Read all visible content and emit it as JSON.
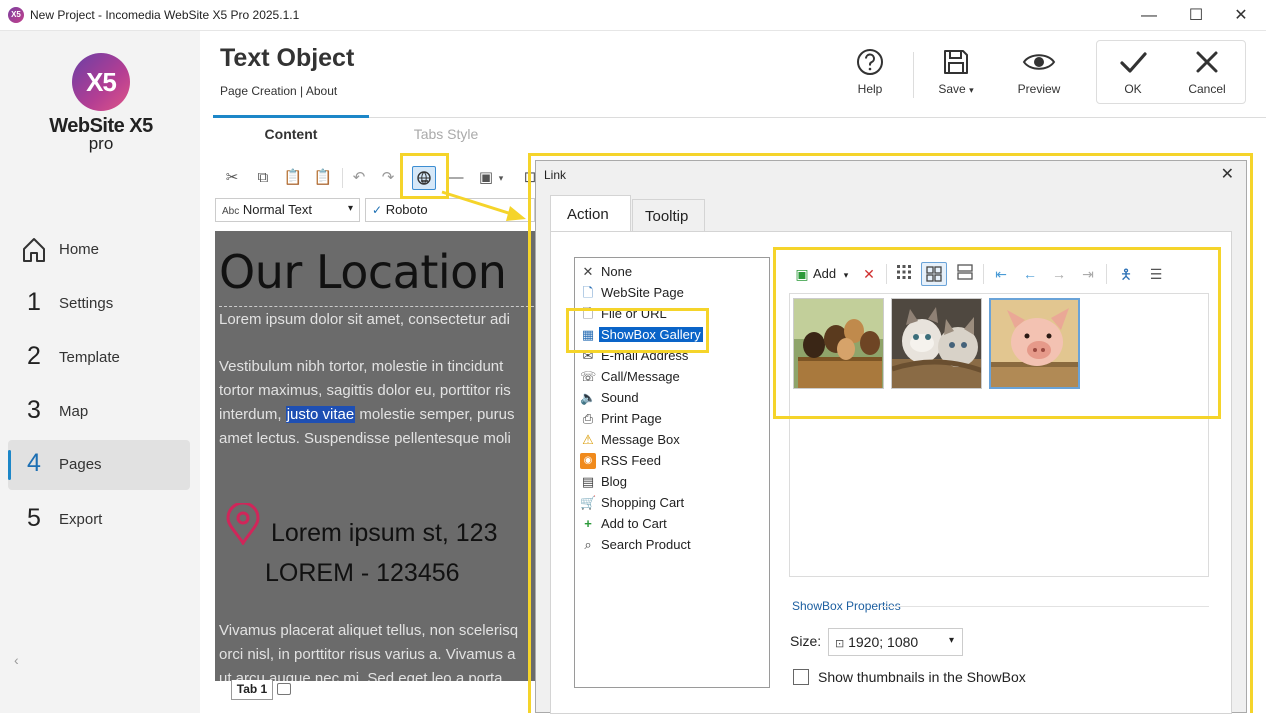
{
  "window": {
    "title": "New Project - Incomedia WebSite X5 Pro 2025.1.1",
    "app_icon": "X5",
    "minimize_icon": "—",
    "maximize_icon": "☐",
    "close_icon": "✕"
  },
  "logo": {
    "mark": "X5",
    "name": "WebSite X5",
    "edition": "pro"
  },
  "sidebar": {
    "items": [
      {
        "num": "",
        "label": "Home",
        "icon": "home-icon"
      },
      {
        "num": "1",
        "label": "Settings"
      },
      {
        "num": "2",
        "label": "Template"
      },
      {
        "num": "3",
        "label": "Map"
      },
      {
        "num": "4",
        "label": "Pages",
        "active": true
      },
      {
        "num": "5",
        "label": "Export"
      }
    ],
    "collapse_glyph": "‹"
  },
  "header": {
    "title": "Text Object",
    "breadcrumb": "Page Creation | About",
    "buttons": {
      "help": "Help",
      "save": "Save",
      "save_arrow": "▾",
      "preview": "Preview",
      "ok": "OK",
      "cancel": "Cancel"
    }
  },
  "tabs": {
    "content": "Content",
    "tabs_style": "Tabs Style"
  },
  "editor_toolbar": {
    "style_prefix": "Abc",
    "style_value": "Normal Text",
    "font_check": "✓",
    "font_value": "Roboto",
    "combo_arrow": "▾"
  },
  "editor": {
    "heading": "Our Location",
    "para1": "Lorem ipsum dolor sit amet, consectetur adi",
    "para2_line1": "Vestibulum nibh tortor, molestie in tincidunt",
    "para2_line2": "tortor maximus, sagittis dolor eu, porttitor ris",
    "para2_line3_a": "interdum, ",
    "para2_line3_sel": "justo vitae",
    "para2_line3_b": " molestie semper, purus",
    "para2_line4": "amet lectus. Suspendisse pellentesque moli",
    "address1": "Lorem ipsum st, 123",
    "address2": "LOREM - 123456",
    "para3_line1": "Vivamus placerat aliquet tellus, non scelerisq",
    "para3_line2": "orci nisl, in porttitor risus varius a. Vivamus a",
    "para3_line3": "ut arcu augue nec mi. Sed eget leo a porta"
  },
  "editor_tabs": {
    "tab1": "Tab 1"
  },
  "link_dialog": {
    "title": "Link",
    "close": "✕",
    "tabs": {
      "action": "Action",
      "tooltip": "Tooltip"
    },
    "actions": [
      {
        "label": "None",
        "icon": "none-x-icon",
        "glyph": "✕"
      },
      {
        "label": "WebSite Page",
        "icon": "page-icon",
        "glyph": "🗋"
      },
      {
        "label": "File or URL",
        "icon": "file-icon",
        "glyph": "🗋"
      },
      {
        "label": "ShowBox Gallery",
        "icon": "gallery-icon",
        "glyph": "▦",
        "selected": true
      },
      {
        "label": "E-mail Address",
        "icon": "email-icon",
        "glyph": "✉"
      },
      {
        "label": "Call/Message",
        "icon": "phone-icon",
        "glyph": "☏"
      },
      {
        "label": "Sound",
        "icon": "speaker-icon",
        "glyph": "🔈"
      },
      {
        "label": "Print Page",
        "icon": "printer-icon",
        "glyph": "⎙"
      },
      {
        "label": "Message Box",
        "icon": "warning-icon",
        "glyph": "⚠"
      },
      {
        "label": "RSS Feed",
        "icon": "rss-icon",
        "glyph": "◉"
      },
      {
        "label": "Blog",
        "icon": "blog-icon",
        "glyph": "▤"
      },
      {
        "label": "Shopping Cart",
        "icon": "cart-icon",
        "glyph": "🛒"
      },
      {
        "label": "Add to Cart",
        "icon": "add-cart-icon",
        "glyph": "+"
      },
      {
        "label": "Search Product",
        "icon": "search-product-icon",
        "glyph": "⌕"
      }
    ],
    "gallery": {
      "add": "Add",
      "add_arrow": "▾",
      "remove": "✕"
    },
    "properties": {
      "title": "ShowBox Properties",
      "size_label": "Size:",
      "size_value": "1920; 1080",
      "show_thumbs": "Show thumbnails in the ShowBox"
    }
  },
  "colors": {
    "accent": "#1d87c8",
    "highlight": "#f5d42a",
    "selection": "#0a64c8"
  }
}
